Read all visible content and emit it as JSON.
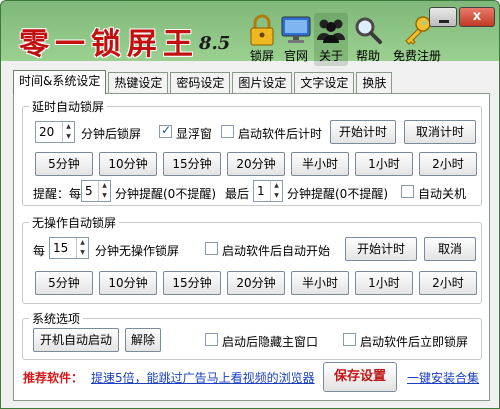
{
  "app": {
    "title": "零一锁屏王",
    "version": "8.5"
  },
  "header_buttons": [
    {
      "label": "锁屏",
      "icon": "lock-icon"
    },
    {
      "label": "官网",
      "icon": "monitor-icon"
    },
    {
      "label": "关于",
      "icon": "users-icon"
    },
    {
      "label": "帮助",
      "icon": "magnifier-icon"
    },
    {
      "label": "免费注册",
      "icon": "key-icon"
    }
  ],
  "window_controls": {
    "close": "x"
  },
  "tabs": [
    "时间&系统设定",
    "热键设定",
    "密码设定",
    "图片设定",
    "文字设定",
    "换肤"
  ],
  "active_tab": 0,
  "delay_group": {
    "legend": "延时自动锁屏",
    "minutes_value": "20",
    "minutes_suffix": "分钟后锁屏",
    "float_window": {
      "label": "显浮窗",
      "checked": true
    },
    "start_timer_on_launch": {
      "label": "启动软件后计时",
      "checked": false
    },
    "start_button": "开始计时",
    "cancel_button": "取消计时",
    "presets": [
      "5分钟",
      "10分钟",
      "15分钟",
      "20分钟",
      "半小时",
      "1小时",
      "2小时"
    ],
    "reminder_prefix": "提醒：每",
    "reminder_every_value": "5",
    "reminder_every_suffix": "分钟提醒(0不提醒)",
    "reminder_last_prefix": "最后",
    "reminder_last_value": "1",
    "reminder_last_suffix": "分钟提醒(0不提醒)",
    "auto_shutdown": {
      "label": "自动关机",
      "checked": false
    }
  },
  "idle_group": {
    "legend": "无操作自动锁屏",
    "prefix": "每",
    "minutes_value": "15",
    "minutes_suffix": "分钟无操作锁屏",
    "auto_start": {
      "label": "启动软件后自动开始",
      "checked": false
    },
    "start_button": "开始计时",
    "cancel_button": "取消",
    "presets": [
      "5分钟",
      "10分钟",
      "15分钟",
      "20分钟",
      "半小时",
      "1小时",
      "2小时"
    ]
  },
  "system_group": {
    "legend": "系统选项",
    "autostart_button": "开机自动启动",
    "remove_button": "解除",
    "hide_main_window": {
      "label": "启动后隐藏主窗口",
      "checked": false
    },
    "lock_on_launch": {
      "label": "启动软件后立即锁屏",
      "checked": false
    }
  },
  "footer": {
    "recommend_label": "推荐软件：",
    "recommend_link": "提速5倍，能跳过广告马上看视频的浏览器",
    "save_button": "保存设置",
    "install_link": "一键安装合集"
  },
  "colors": {
    "title_red": "#c21010",
    "header_green": "#8ec485",
    "link_blue": "#1a3fbf"
  }
}
